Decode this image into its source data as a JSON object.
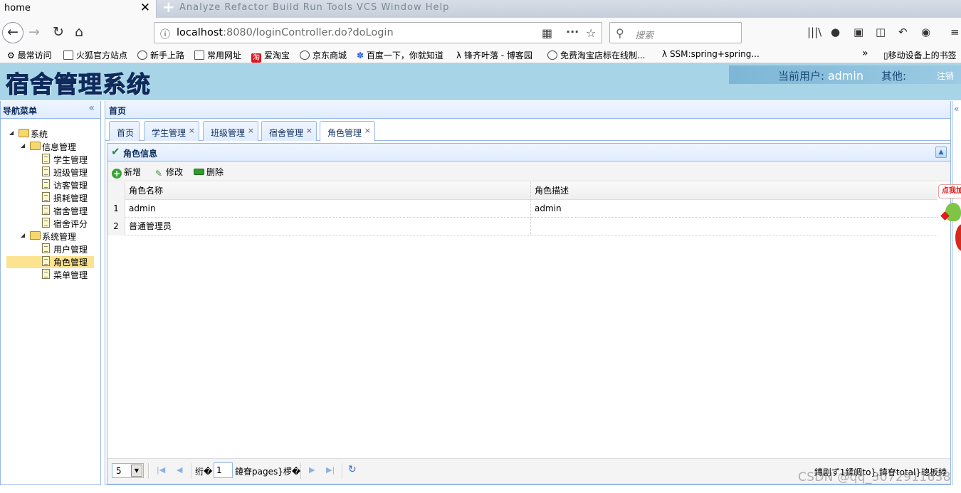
{
  "browser": {
    "tab_title": "home",
    "tab_close": "✕",
    "new_tab": "+",
    "ghost_menu": "Analyze  Refactor  Build  Run  Tools  VCS  Window  Help",
    "url_host": "localhost",
    "url_rest": ":8080/loginController.do?doLogin",
    "search_placeholder": "搜索",
    "bookmarks": [
      "最常访问",
      "火狐官方站点",
      "新手上路",
      "常用网址",
      "爱淘宝",
      "京东商城",
      "百度一下，你就知道",
      "锋齐叶落 - 博客园",
      "免费淘宝店标在线制...",
      "SSM:spring+spring...",
      "移动设备上的书签"
    ],
    "bookmark_taobao_icon": "淘"
  },
  "header": {
    "logo": "宿舍管理系统",
    "current_user_label": "当前用户: ",
    "current_user": "admin",
    "other_label": "其他:",
    "logout": "注销"
  },
  "sidebar": {
    "title": "导航菜单",
    "collapse": "«",
    "root": "系统",
    "groups": [
      {
        "label": "信息管理",
        "items": [
          "学生管理",
          "班级管理",
          "访客管理",
          "损耗管理",
          "宿舍管理",
          "宿舍评分"
        ]
      },
      {
        "label": "系统管理",
        "items": [
          "用户管理",
          "角色管理",
          "菜单管理"
        ]
      }
    ],
    "selected": "角色管理"
  },
  "main": {
    "title": "首页",
    "tabs": [
      {
        "label": "首页",
        "closable": false
      },
      {
        "label": "学生管理",
        "closable": true
      },
      {
        "label": "班级管理",
        "closable": true
      },
      {
        "label": "宿舍管理",
        "closable": true
      },
      {
        "label": "角色管理",
        "closable": true
      }
    ],
    "active_tab": "角色管理",
    "tab_close": "×"
  },
  "role_panel": {
    "title": "角色信息",
    "toolbar": {
      "add": "新增",
      "edit": "修改",
      "delete": "删除"
    },
    "columns": [
      "角色名称",
      "角色描述"
    ],
    "rows": [
      {
        "num": "1",
        "name": "admin",
        "desc": "admin"
      },
      {
        "num": "2",
        "name": "普通管理员",
        "desc": ""
      }
    ]
  },
  "pager": {
    "page_size": "5",
    "before_page": "绗�",
    "page_number": "1",
    "after_page": "鍏眘pages}椤�",
    "info": "鏄剧ず1鍒皗to},鍏眘total}璁板綍"
  },
  "widget": {
    "bubble": "点我加"
  },
  "watermark": "CSDN @qq_3072911638",
  "colors": {
    "header_bg": "#a8d4e8",
    "panel_border": "#95b8e7",
    "selected_row": "#fbe38f",
    "logo": "#0e2b5c"
  }
}
